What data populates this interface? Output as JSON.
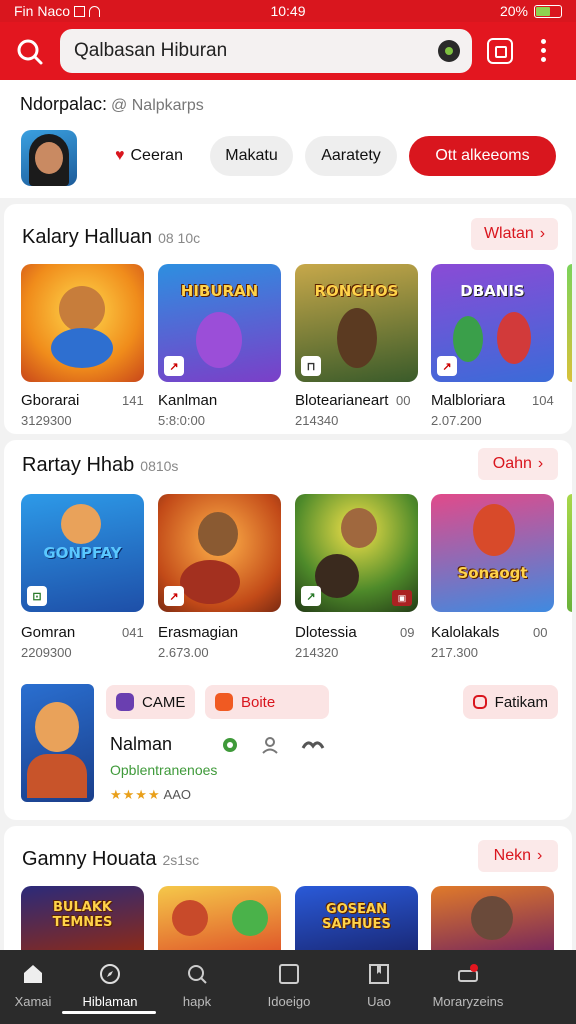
{
  "status_bar": {
    "carrier": "Fin Naco",
    "time": "10:49",
    "battery_pct": "20%",
    "battery_level": 0.6
  },
  "search": {
    "placeholder": "Qalbasan Hiburan"
  },
  "header": {
    "title": "Ndorpalac:",
    "subtitle": "@ Nalpkarps"
  },
  "filters": [
    {
      "label": "Ceeran"
    },
    {
      "label": "Makatu"
    },
    {
      "label": "Aaratety"
    },
    {
      "label": "Ott alkeeoms"
    }
  ],
  "sections": [
    {
      "title": "Kalary Halluan",
      "count": "08 10c",
      "more_label": "Wlatan",
      "items": [
        {
          "name": "Gborarai",
          "side": "141",
          "downloads": "3129300",
          "banner": ""
        },
        {
          "name": "Kanlman",
          "side": "",
          "downloads": "5:8:0:00",
          "banner": "HIBURAN"
        },
        {
          "name": "Blotearianeart",
          "side": "00",
          "downloads": "214340",
          "banner": "RONCHOS"
        },
        {
          "name": "Malbloriara",
          "side": "104",
          "downloads": "2.07.200",
          "banner": "DBANIS"
        }
      ]
    },
    {
      "title": "Rartay Hhab",
      "count": "0810s",
      "more_label": "Oahn",
      "items": [
        {
          "name": "Gomran",
          "side": "041",
          "downloads": "2209300",
          "banner": "GONPFAY"
        },
        {
          "name": "Erasmagian",
          "side": "",
          "downloads": "2.673.00",
          "banner": ""
        },
        {
          "name": "Dlotessia",
          "side": "09",
          "downloads": "214320",
          "banner": ""
        },
        {
          "name": "Kalolakals",
          "side": "00",
          "downloads": "217.300",
          "banner": "Sonaogt"
        }
      ]
    },
    {
      "title": "Gamny Houata",
      "count": "2s1sc",
      "more_label": "Nekn",
      "items": [
        {
          "banner": "BULAKK TEMNES"
        },
        {
          "banner": ""
        },
        {
          "banner": "GOSEAN SAPHUES"
        },
        {
          "banner": ""
        }
      ]
    }
  ],
  "featured": {
    "tag_game": "CAME",
    "tag_orange": "Boite",
    "action_label": "Fatikam",
    "name": "Nalman",
    "subtitle": "Opblentranenoes",
    "rating_stars": "★★★★",
    "rating_text": "AAO"
  },
  "bottom_nav": [
    {
      "label": "Xamai",
      "icon": "home-icon"
    },
    {
      "label": "Hiblaman",
      "icon": "compass-icon"
    },
    {
      "label": "hapk",
      "icon": "search-icon"
    },
    {
      "label": "Idoeigo",
      "icon": "square-icon"
    },
    {
      "label": "Uao",
      "icon": "book-icon"
    },
    {
      "label": "Moraryzeins",
      "icon": "profile-icon"
    }
  ],
  "colors": {
    "brand_red": "#d9161e",
    "nav_bg": "#2b2b2b"
  }
}
